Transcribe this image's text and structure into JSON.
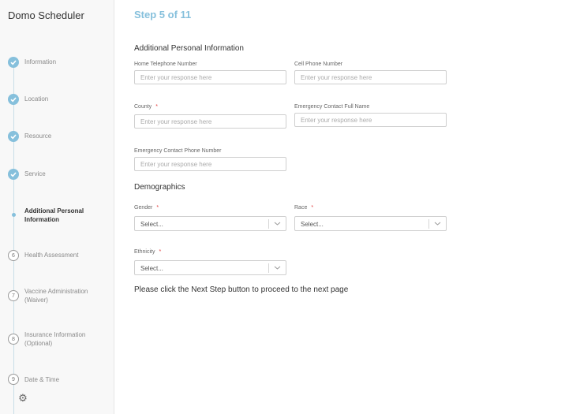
{
  "app": {
    "title": "Domo Scheduler"
  },
  "steps": [
    {
      "label": "Information",
      "status": "done"
    },
    {
      "label": "Location",
      "status": "done"
    },
    {
      "label": "Resource",
      "status": "done"
    },
    {
      "label": "Service",
      "status": "done"
    },
    {
      "label": "Additional Personal Information",
      "status": "current"
    },
    {
      "number": "6",
      "label": "Health Assessment",
      "status": "todo"
    },
    {
      "number": "7",
      "label": "Vaccine Administration (Waiver)",
      "status": "todo"
    },
    {
      "number": "8",
      "label": "Insurance Information (Optional)",
      "status": "todo"
    },
    {
      "number": "9",
      "label": "Date & Time",
      "status": "todo"
    }
  ],
  "header": {
    "step_count": "Step 5 of 11"
  },
  "sections": {
    "personal_title": "Additional Personal Information",
    "demographics_title": "Demographics"
  },
  "fields": {
    "home_phone": {
      "label": "Home Telephone Number",
      "placeholder": "Enter your response here"
    },
    "cell_phone": {
      "label": "Cell Phone Number",
      "placeholder": "Enter your response here"
    },
    "county": {
      "label": "County",
      "required": "*",
      "placeholder": "Enter your response here"
    },
    "emergency_name": {
      "label": "Emergency Contact Full Name",
      "placeholder": "Enter your response here"
    },
    "emergency_phone": {
      "label": "Emergency Contact Phone Number",
      "placeholder": "Enter your response here"
    },
    "gender": {
      "label": "Gender",
      "required": "*",
      "value": "Select..."
    },
    "race": {
      "label": "Race",
      "required": "*",
      "value": "Select..."
    },
    "ethnicity": {
      "label": "Ethnicity",
      "required": "*",
      "value": "Select..."
    }
  },
  "note": "Please click the Next Step button to proceed to the next page",
  "colors": {
    "accent": "#86c0dc",
    "required": "#e03b3b"
  },
  "icons": {
    "done": "check-icon",
    "settings": "gear-icon",
    "select": "chevron-down-icon"
  }
}
